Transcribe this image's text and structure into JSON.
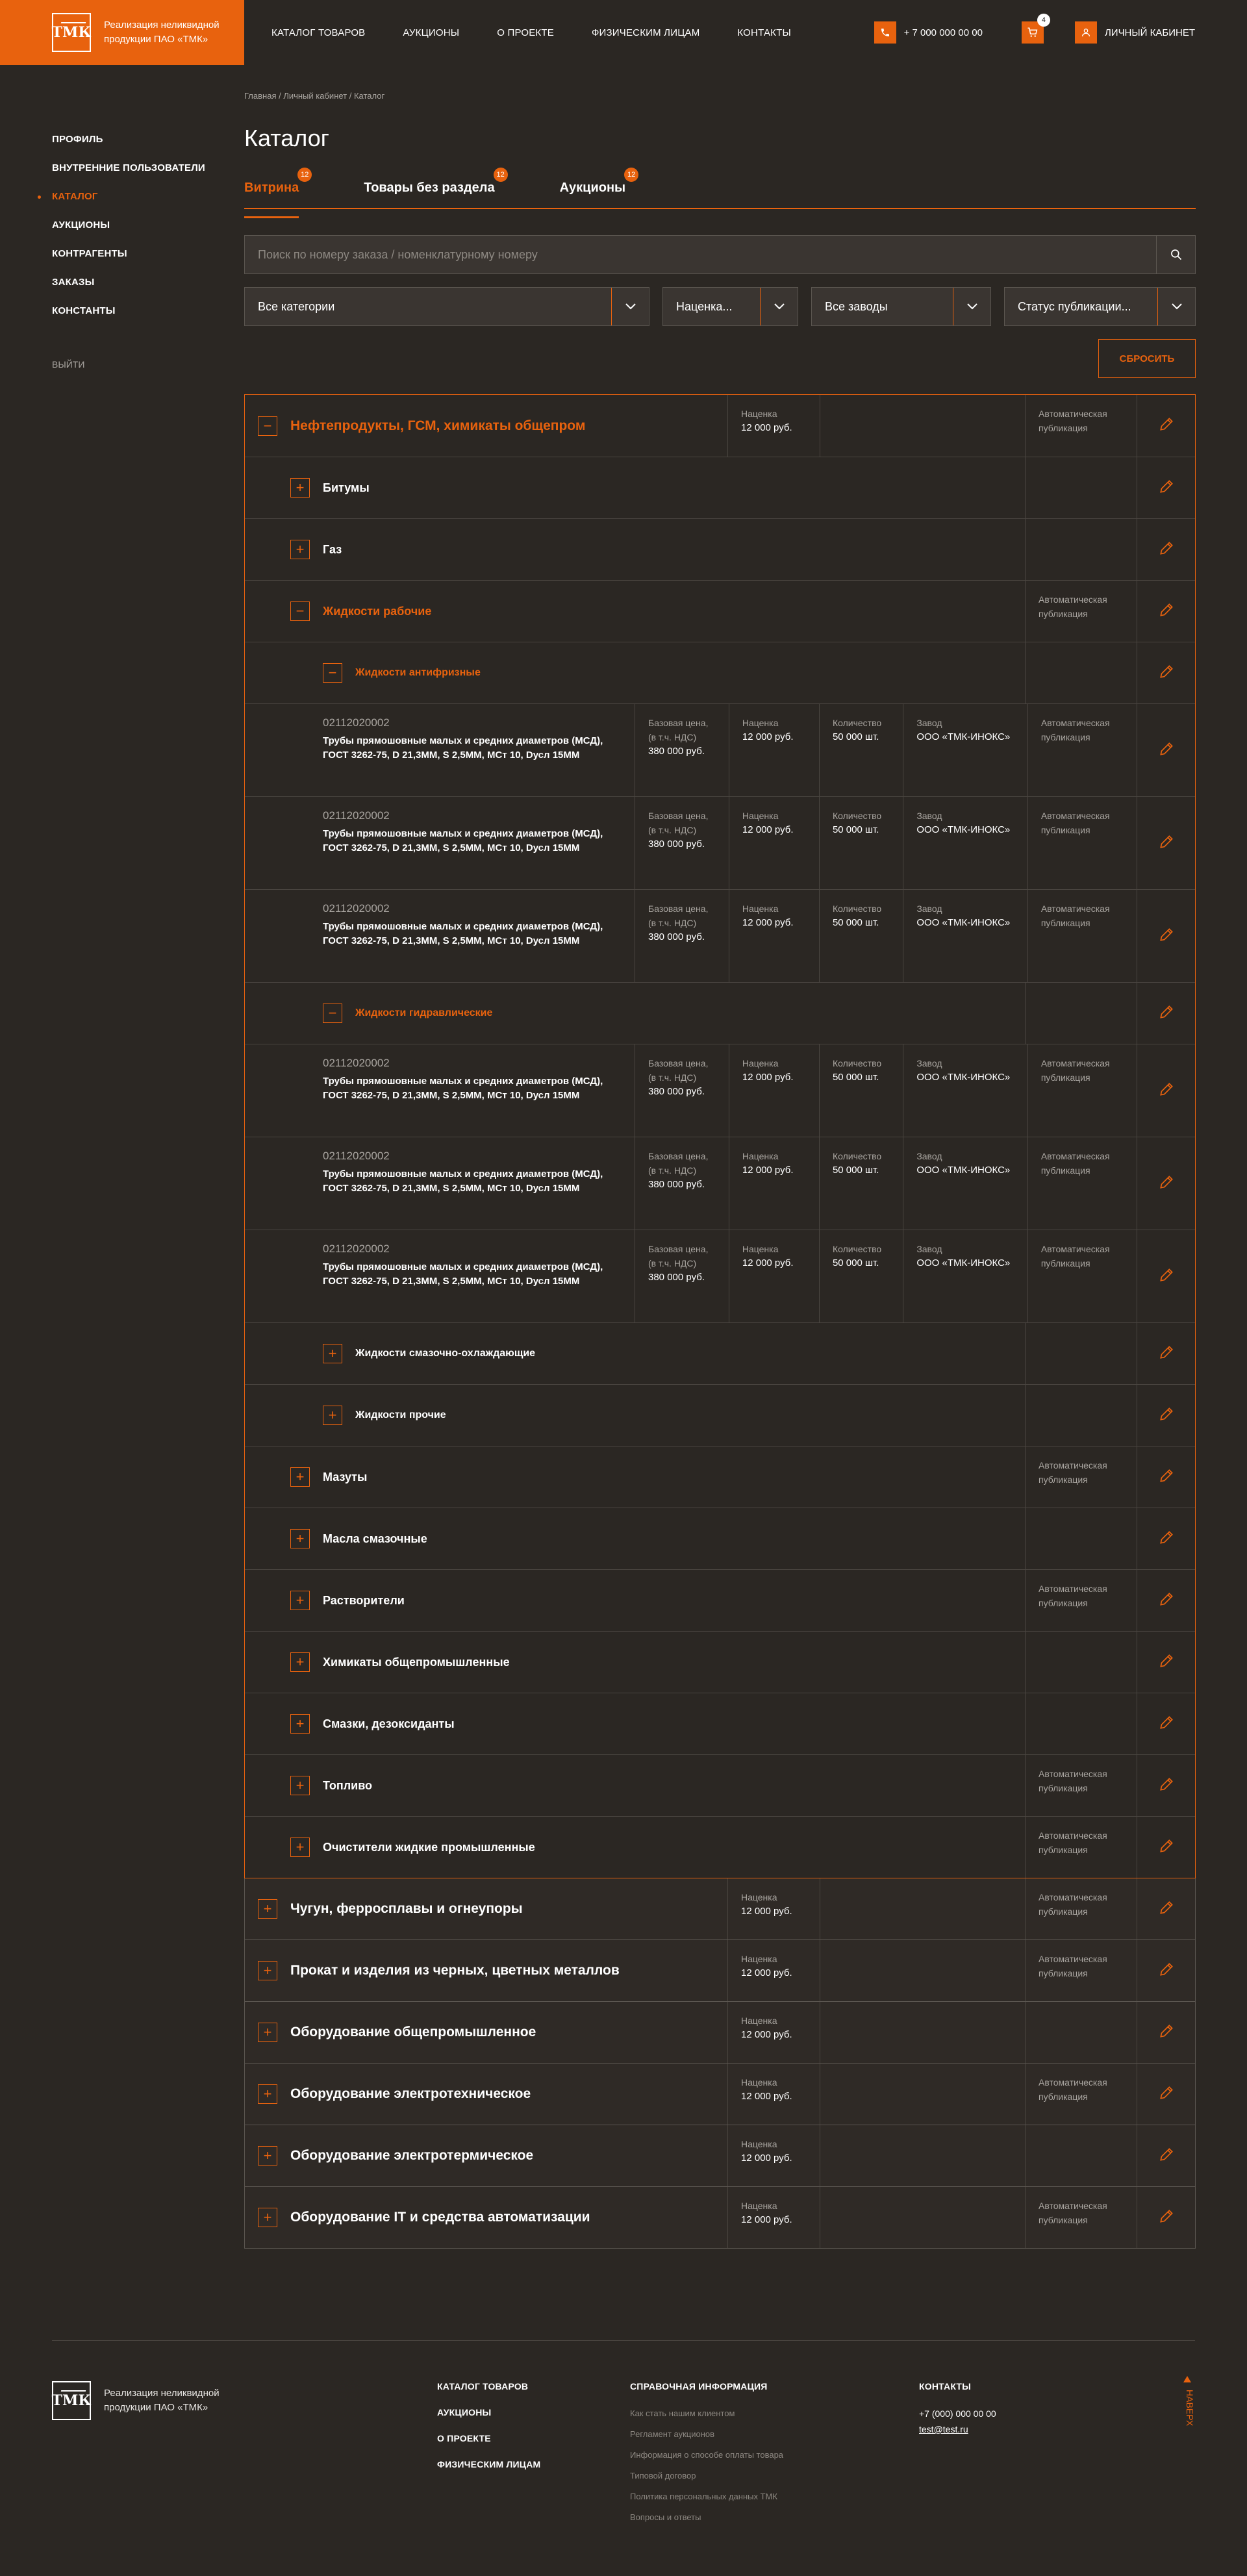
{
  "header": {
    "logo_text": "Реализация неликвидной продукции ПАО «ТМК»",
    "nav": [
      "КАТАЛОГ ТОВАРОВ",
      "АУКЦИОНЫ",
      "О ПРОЕКТЕ",
      "ФИЗИЧЕСКИМ ЛИЦАМ",
      "КОНТАКТЫ"
    ],
    "phone": "+ 7 000 000 00 00",
    "cart_count": "4",
    "cabinet": "ЛИЧНЫЙ КАБИНЕТ"
  },
  "sidebar": {
    "items": [
      "ПРОФИЛЬ",
      "ВНУТРЕННИЕ ПОЛЬЗОВАТЕЛИ",
      "КАТАЛОГ",
      "АУКЦИОНЫ",
      "КОНТРАГЕНТЫ",
      "ЗАКАЗЫ",
      "КОНСТАНТЫ"
    ],
    "active": "КАТАЛОГ",
    "logout": "ВЫЙТИ"
  },
  "breadcrumb": "Главная  /  Личный кабинет  /  Каталог",
  "title": "Каталог",
  "tabs": [
    {
      "label": "Витрина",
      "badge": "12"
    },
    {
      "label": "Товары без раздела",
      "badge": "12"
    },
    {
      "label": "Аукционы",
      "badge": "12"
    }
  ],
  "search": {
    "placeholder": "Поиск по номеру заказа / номенклатурному номеру"
  },
  "filters": {
    "category": "Все категории",
    "markup": "Наценка...",
    "plant": "Все заводы",
    "status": "Статус публикации..."
  },
  "reset": "СБРОСИТЬ",
  "labels": {
    "markup": "Наценка",
    "base": "Базовая цена, (в т.ч. НДС)",
    "qty": "Количество",
    "plant": "Завод",
    "auto": "Автоматическая публикация"
  },
  "values": {
    "markup": "12 000 руб.",
    "base": "380 000 руб.",
    "qty": "50 000 шт.",
    "plant": "ООО «ТМК-ИНОКС»"
  },
  "product": {
    "code": "02112020002",
    "title": "Трубы прямошовные малых и средних диаметров (МСД), ГОСТ 3262-75, D 21,3ММ, S 2,5ММ, МСт 10, Dусл 15ММ"
  },
  "categories": {
    "root": "Нефтепродукты, ГСМ, химикаты общепром",
    "bitumen": "Битумы",
    "gas": "Газ",
    "work_fluids": "Жидкости рабочие",
    "antifreeze": "Жидкости антифризные",
    "hydraulic": "Жидкости гидравлические",
    "coolant": "Жидкости смазочно-охлаждающие",
    "other_fluids": "Жидкости прочие",
    "fuel_oil": "Мазуты",
    "lube_oils": "Масла смазочные",
    "solvents": "Растворители",
    "chemicals": "Химикаты общепромышленные",
    "greases": "Смазки, дезоксиданты",
    "fuel": "Топливо",
    "cleaners": "Очистители жидкие промышленные",
    "iron": "Чугун, ферросплавы и огнеупоры",
    "rolled": "Прокат и изделия из черных, цветных металлов",
    "equip_general": "Оборудование общепромышленное",
    "equip_electro": "Оборудование электротехническое",
    "equip_thermal": "Оборудование электротермическое",
    "equip_it": "Оборудование IT и средства автоматизации"
  },
  "footer": {
    "logo_text": "Реализация неликвидной продукции ПАО «ТМК»",
    "links": [
      "КАТАЛОГ ТОВАРОВ",
      "АУКЦИОНЫ",
      "О ПРОЕКТЕ",
      "ФИЗИЧЕСКИМ ЛИЦАМ"
    ],
    "info_title": "СПРАВОЧНАЯ ИНФОРМАЦИЯ",
    "info_links": [
      "Как стать нашим клиентом",
      "Регламент аукционов",
      "Информация о способе оплаты товара",
      "Типовой договор",
      "Политика персональных данных ТМК",
      "Вопросы и ответы"
    ],
    "contacts_title": "КОНТАКТЫ",
    "phone": "+7 (000) 000 00 00",
    "email": "test@test.ru",
    "up": "НАВЕРХ"
  },
  "colors": {
    "accent": "#e8620e",
    "bg": "#2b2723"
  }
}
